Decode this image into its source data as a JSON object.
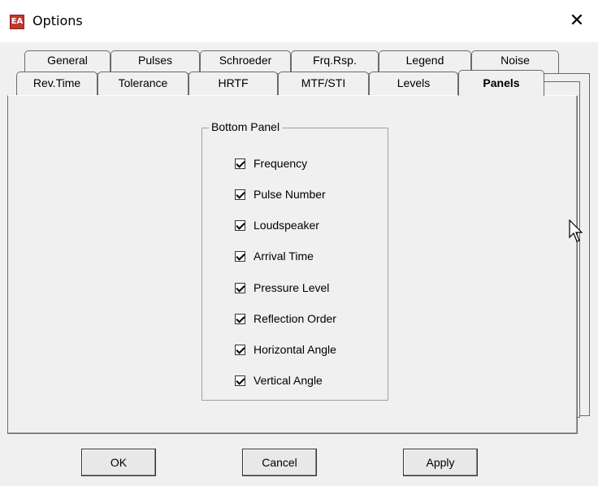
{
  "window": {
    "title": "Options",
    "icon": "app-logo-icon",
    "close_glyph": "✕"
  },
  "tabs": {
    "row1": [
      {
        "label": "General"
      },
      {
        "label": "Pulses"
      },
      {
        "label": "Schroeder"
      },
      {
        "label": "Frq.Rsp."
      },
      {
        "label": "Legend"
      },
      {
        "label": "Noise"
      }
    ],
    "row2": [
      {
        "label": "Rev.Time"
      },
      {
        "label": "Tolerance"
      },
      {
        "label": "HRTF"
      },
      {
        "label": "MTF/STI"
      },
      {
        "label": "Levels"
      },
      {
        "label": "Panels",
        "active": true
      }
    ]
  },
  "group": {
    "title": "Bottom Panel",
    "items": [
      {
        "label": "Frequency",
        "checked": true
      },
      {
        "label": "Pulse Number",
        "checked": true
      },
      {
        "label": "Loudspeaker",
        "checked": true
      },
      {
        "label": "Arrival Time",
        "checked": true
      },
      {
        "label": "Pressure Level",
        "checked": true
      },
      {
        "label": "Reflection Order",
        "checked": true
      },
      {
        "label": "Horizontal Angle",
        "checked": true
      },
      {
        "label": "Vertical Angle",
        "checked": true
      }
    ]
  },
  "buttons": {
    "ok": "OK",
    "cancel": "Cancel",
    "apply": "Apply"
  }
}
